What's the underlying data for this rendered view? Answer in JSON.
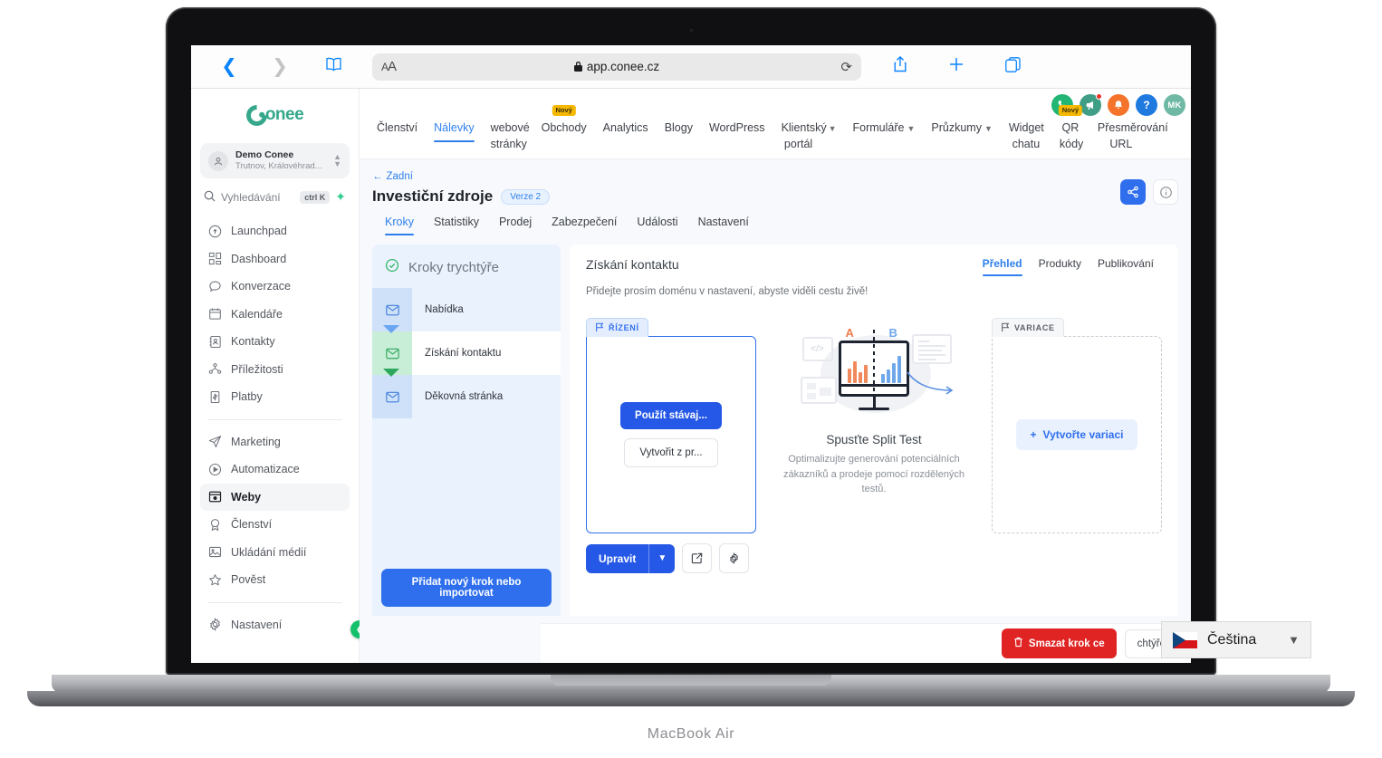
{
  "device": {
    "label": "MacBook Air"
  },
  "browser": {
    "back_icon": "chevron-left-icon",
    "forward_icon": "chevron-right-icon",
    "sidebar_icon": "book-icon",
    "text_size_label": "A",
    "text_size_label_big": "A",
    "lock_icon": "lock-icon",
    "url": "app.conee.cz",
    "reload_icon": "reload-icon",
    "share_icon": "share-icon",
    "new_tab_icon": "plus-icon",
    "tabs_icon": "tabs-icon"
  },
  "sidebar": {
    "logo_text": "onee",
    "account": {
      "name": "Demo Conee",
      "location": "Trutnov, Královéhrad...",
      "avatar_icon": "user-location-icon",
      "chevron_icon": "chevron-updown-icon"
    },
    "search": {
      "placeholder": "Vyhledávání",
      "shortcut": "ctrl K",
      "icon": "search-icon",
      "spark_icon": "sparkle-icon"
    },
    "groups": [
      {
        "items": [
          {
            "label": "Launchpad",
            "icon": "rocket-icon",
            "active": false
          },
          {
            "label": "Dashboard",
            "icon": "grid-icon",
            "active": false
          },
          {
            "label": "Konverzace",
            "icon": "chat-bubble-icon",
            "active": false
          },
          {
            "label": "Kalendáře",
            "icon": "calendar-icon",
            "active": false
          },
          {
            "label": "Kontakty",
            "icon": "contacts-icon",
            "active": false
          },
          {
            "label": "Příležitosti",
            "icon": "opportunities-icon",
            "active": false
          },
          {
            "label": "Platby",
            "icon": "payments-icon",
            "active": false
          }
        ]
      },
      {
        "items": [
          {
            "label": "Marketing",
            "icon": "send-icon",
            "active": false
          },
          {
            "label": "Automatizace",
            "icon": "play-circle-icon",
            "active": false
          },
          {
            "label": "Weby",
            "icon": "sites-icon",
            "active": true
          },
          {
            "label": "Členství",
            "icon": "badge-icon",
            "active": false
          },
          {
            "label": "Ukládání médií",
            "icon": "image-icon",
            "active": false
          },
          {
            "label": "Pověst",
            "icon": "star-icon",
            "active": false
          }
        ]
      },
      {
        "items": [
          {
            "label": "Nastavení",
            "icon": "gear-icon",
            "active": false
          }
        ]
      }
    ],
    "collapse_icon": "chevron-left-icon"
  },
  "topnav": {
    "tabs": [
      {
        "label": "Členství",
        "active": false,
        "two_line": false,
        "badge": "",
        "chevron": false
      },
      {
        "label": "Nálevky",
        "active": true,
        "two_line": false,
        "badge": "",
        "chevron": false
      },
      {
        "label": "webové stránky",
        "active": false,
        "two_line": true,
        "badge": "",
        "chevron": false
      },
      {
        "label": "Obchody",
        "active": false,
        "two_line": false,
        "badge": "Nový",
        "chevron": false
      },
      {
        "label": "Analytics",
        "active": false,
        "two_line": false,
        "badge": "",
        "chevron": false
      },
      {
        "label": "Blogy",
        "active": false,
        "two_line": false,
        "badge": "",
        "chevron": false
      },
      {
        "label": "WordPress",
        "active": false,
        "two_line": false,
        "badge": "",
        "chevron": false
      },
      {
        "label": "Klientský portál",
        "active": false,
        "two_line": true,
        "badge": "",
        "chevron": true
      },
      {
        "label": "Formuláře",
        "active": false,
        "two_line": false,
        "badge": "",
        "chevron": true
      },
      {
        "label": "Průzkumy",
        "active": false,
        "two_line": false,
        "badge": "",
        "chevron": true
      },
      {
        "label": "Widget chatu",
        "active": false,
        "two_line": true,
        "badge": "",
        "chevron": false
      },
      {
        "label": "QR kódy",
        "active": false,
        "two_line": true,
        "badge": "Nový",
        "chevron": false
      },
      {
        "label": "Přesměrování URL",
        "active": false,
        "two_line": true,
        "badge": "",
        "chevron": false
      }
    ],
    "actions": [
      {
        "name": "phone-icon",
        "glyph": "✆",
        "color": "#22b573",
        "dot": false
      },
      {
        "name": "megaphone-icon",
        "glyph": "ᴘ",
        "color": "#3f9e85",
        "dot": true
      },
      {
        "name": "bell-icon",
        "glyph": "ᴅ",
        "color": "#f5732a",
        "dot": false
      },
      {
        "name": "help-icon",
        "glyph": "?",
        "color": "#1f7ae0",
        "dot": false
      },
      {
        "name": "avatar",
        "glyph": "MK",
        "color": "#6fb9a4",
        "dot": false
      }
    ]
  },
  "page": {
    "back_label": "Zadní",
    "title": "Investiční zdroje",
    "version_badge": "Verze 2",
    "share_icon": "share-nodes-icon",
    "info_icon": "info-icon",
    "subtabs": [
      {
        "label": "Kroky",
        "active": true
      },
      {
        "label": "Statistiky",
        "active": false
      },
      {
        "label": "Prodej",
        "active": false
      },
      {
        "label": "Zabezpečení",
        "active": false
      },
      {
        "label": "Události",
        "active": false
      },
      {
        "label": "Nastavení",
        "active": false
      }
    ]
  },
  "steps_panel": {
    "heading": "Kroky trychtýře",
    "heading_icon": "check-circle-icon",
    "steps": [
      {
        "label": "Nabídka",
        "icon": "envelope-icon",
        "current": false
      },
      {
        "label": "Získání kontaktu",
        "icon": "envelope-icon",
        "current": true
      },
      {
        "label": "Děkovná stránka",
        "icon": "envelope-icon",
        "current": false
      }
    ],
    "add_step_label": "Přidat nový krok nebo importovat"
  },
  "detail": {
    "title": "Získání kontaktu",
    "tabs": [
      {
        "label": "Přehled",
        "active": true
      },
      {
        "label": "Produkty",
        "active": false
      },
      {
        "label": "Publikování",
        "active": false
      }
    ],
    "hint": "Přidejte prosím doménu v nastavení, abyste viděli cestu živě!",
    "control": {
      "flag_label": "ŘÍZENÍ",
      "flag_icon": "flag-icon",
      "use_existing_label": "Použít stávaj...",
      "create_from_label": "Vytvořit z pr...",
      "edit_label": "Upravit",
      "edit_chevron_icon": "chevron-down-icon",
      "open_external_icon": "external-link-icon",
      "settings_icon": "gear-icon"
    },
    "split_test": {
      "title": "Spusťte Split Test",
      "description": "Optimalizujte generování potenciálních zákazníků a prodeje pomocí rozdělených testů.",
      "label_a": "A",
      "label_b": "B",
      "illustration_icon": "split-test-illustration"
    },
    "variation": {
      "flag_label": "VARIACE",
      "flag_icon": "flag-icon",
      "create_label": "Vytvořte variaci",
      "plus_icon": "plus-icon"
    }
  },
  "bottombar": {
    "delete_label": "Smazat krok ce",
    "delete_icon": "trash-icon",
    "secondary_label": "chtýře"
  },
  "language_widget": {
    "name": "Čeština",
    "flag_icon": "czech-flag-icon",
    "chevron_icon": "chevron-down-icon"
  },
  "colors": {
    "accent_blue": "#2f80ed",
    "primary_blue": "#2558e6",
    "brand_green": "#35a88b",
    "danger_red": "#e02424",
    "badge_yellow": "#f5b800",
    "panel_blue": "#eaf2fe",
    "current_green": "#2fa85f"
  }
}
